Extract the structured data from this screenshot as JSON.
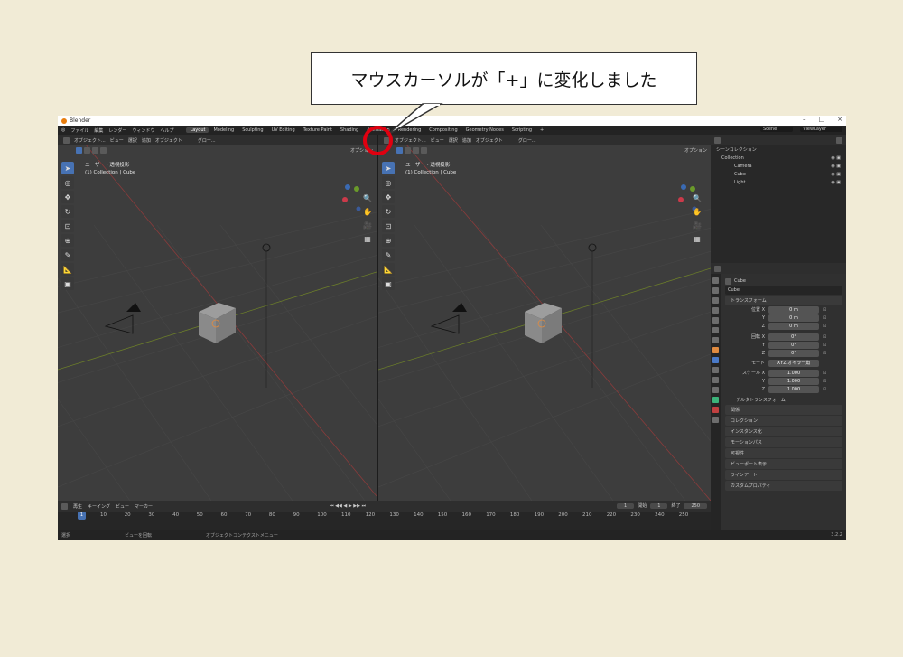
{
  "callout": {
    "text": "マウスカーソルが「+」に変化しました"
  },
  "window": {
    "title": "Blender",
    "min": "–",
    "max": "□",
    "close": "×"
  },
  "topbar": {
    "menu": [
      "ファイル",
      "編集",
      "レンダー",
      "ウィンドウ",
      "ヘルプ"
    ],
    "workspaces": [
      "Layout",
      "Modeling",
      "Sculpting",
      "UV Editing",
      "Texture Paint",
      "Shading",
      "Animation",
      "Rendering",
      "Compositing",
      "Geometry Nodes",
      "Scripting",
      "+"
    ],
    "active_workspace": "Layout",
    "scene": "Scene",
    "viewlayer": "ViewLayer"
  },
  "viewport": {
    "mode": "オブジェクト...",
    "menus": [
      "ビュー",
      "選択",
      "追加",
      "オブジェクト"
    ],
    "transform": "グロー...",
    "options": "オプション",
    "view_label": "ユーザー・透視投影",
    "collection_label": "(1) Collection | Cube"
  },
  "outliner": {
    "title": "シーンコレクション",
    "items": [
      "Collection",
      "Camera",
      "Cube",
      "Light"
    ]
  },
  "properties": {
    "object_name": "Cube",
    "data_name": "Cube",
    "section_transform": "トランスフォーム",
    "location_label": "位置 X",
    "rotation_label": "回転 X",
    "scale_label": "スケール X",
    "y": "Y",
    "z": "Z",
    "loc": [
      "0 m",
      "0 m",
      "0 m"
    ],
    "rot": [
      "0°",
      "0°",
      "0°"
    ],
    "scale": [
      "1.000",
      "1.000",
      "1.000"
    ],
    "mode_label": "モード",
    "mode_value": "XYZ オイラー角",
    "delta": "デルタトランスフォーム",
    "sections": [
      "関係",
      "コレクション",
      "インスタンス化",
      "モーションパス",
      "可視性",
      "ビューポート表示",
      "ラインアート",
      "カスタムプロパティ"
    ]
  },
  "timeline": {
    "menus": [
      "再生",
      "キーイング",
      "ビュー",
      "マーカー"
    ],
    "current": "1",
    "start_label": "開始",
    "start": "1",
    "end_label": "終了",
    "end": "250",
    "ticks": [
      "10",
      "20",
      "30",
      "40",
      "50",
      "60",
      "70",
      "80",
      "90",
      "100",
      "110",
      "120",
      "130",
      "140",
      "150",
      "160",
      "170",
      "180",
      "190",
      "200",
      "210",
      "220",
      "230",
      "240",
      "250"
    ]
  },
  "status": {
    "select": "選択",
    "pan": "ビューを回転",
    "context": "オブジェクトコンテクストメニュー",
    "version": "3.2.2"
  }
}
